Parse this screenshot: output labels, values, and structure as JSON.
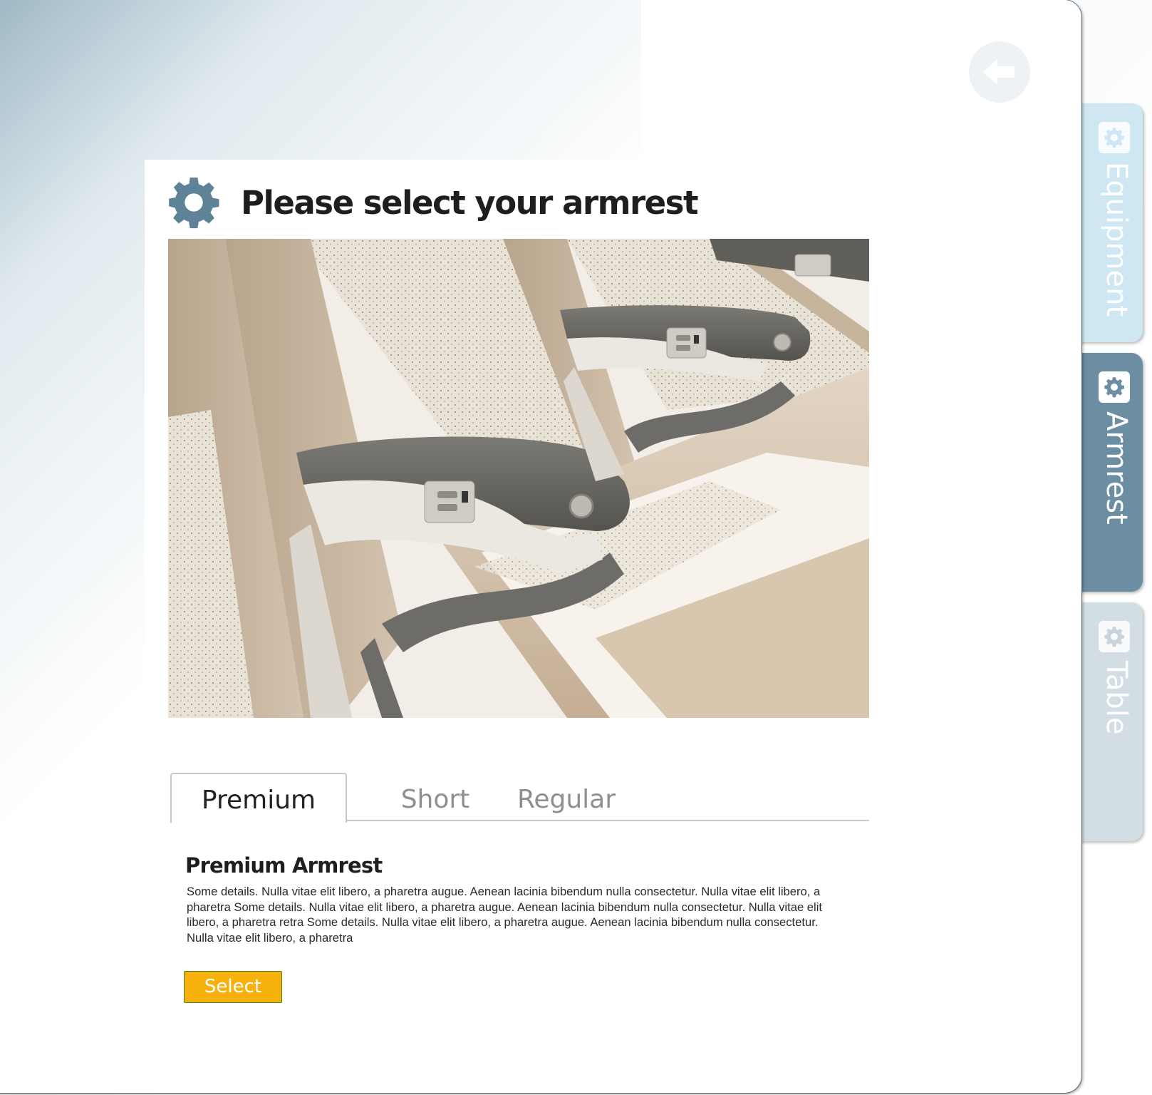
{
  "page": {
    "title": "Please select your armrest",
    "title_icon": "gear-icon",
    "back_icon": "back-arrow-icon"
  },
  "hero_image": {
    "subject": "Aircraft seat row with armrests"
  },
  "options": {
    "tabs": [
      {
        "label": "Premium",
        "active": true
      },
      {
        "label": "Short",
        "active": false
      },
      {
        "label": "Regular",
        "active": false
      }
    ]
  },
  "detail": {
    "title": "Premium Armrest",
    "body": "Some details. Nulla vitae elit libero, a pharetra augue. Aenean lacinia bibendum nulla consectetur. Nulla vitae elit libero, a pharetra Some details. Nulla vitae elit libero, a pharetra augue. Aenean lacinia bibendum nulla consectetur. Nulla vitae elit libero, a pharetra retra Some details. Nulla vitae elit libero, a pharetra augue. Aenean lacinia bibendum nulla consectetur. Nulla vitae elit libero, a pharetra",
    "select_label": "Select"
  },
  "side_nav": {
    "items": [
      {
        "label": "Equipment",
        "icon": "gear-icon",
        "active": false
      },
      {
        "label": "Armrest",
        "icon": "gear-icon",
        "active": true
      },
      {
        "label": "Table",
        "icon": "gear-icon",
        "active": false
      }
    ]
  },
  "colors": {
    "accent": "#5e8398",
    "select_button": "#f7b10d",
    "side_tab_equipment": "#cfe7f3",
    "side_tab_armrest": "#6b8ea2",
    "side_tab_table": "#d3dde4"
  }
}
